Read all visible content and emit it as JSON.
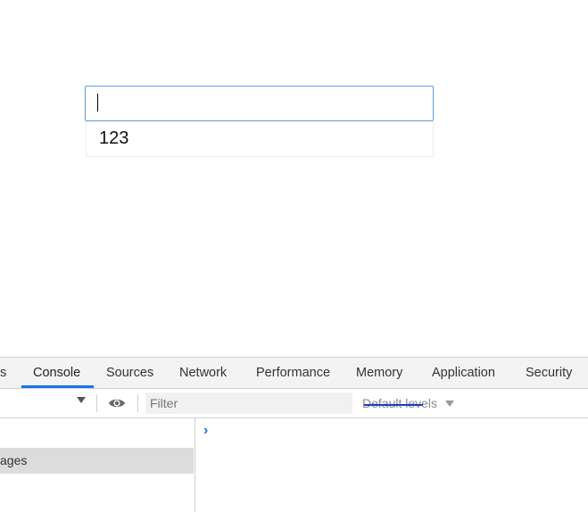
{
  "page": {
    "input_value": "",
    "suggestion_text": "123"
  },
  "devtools": {
    "tabs": [
      {
        "label": "s"
      },
      {
        "label": "Console"
      },
      {
        "label": "Sources"
      },
      {
        "label": "Network"
      },
      {
        "label": "Performance"
      },
      {
        "label": "Memory"
      },
      {
        "label": "Application"
      },
      {
        "label": "Security"
      }
    ],
    "active_tab": "Console",
    "toolbar": {
      "filter_placeholder": "Filter",
      "levels_label": "Default levels"
    },
    "sidebar": {
      "selected_item": "ages"
    },
    "console": {
      "prompt_symbol": "›"
    },
    "accent_color": "#1a73e8"
  }
}
